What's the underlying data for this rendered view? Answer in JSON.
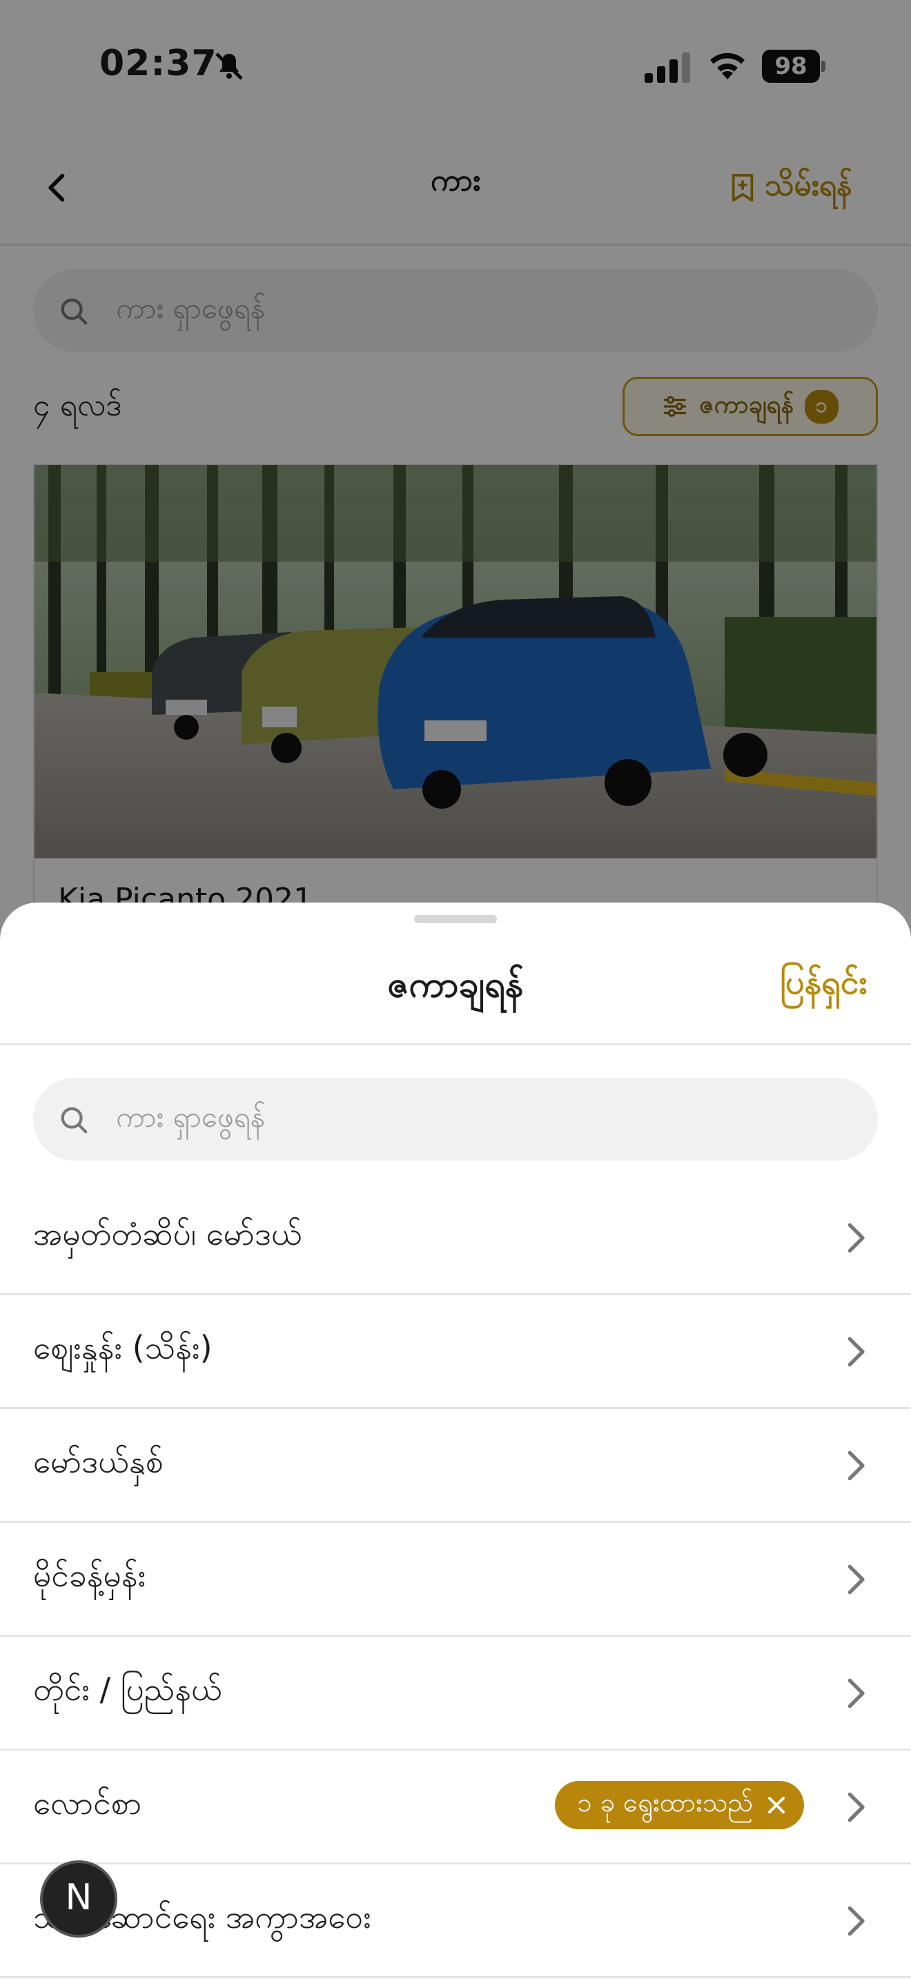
{
  "status_bar": {
    "time": "02:37",
    "battery": "98"
  },
  "nav": {
    "title": "ကား",
    "save_label": "သိမ်းရန်"
  },
  "search": {
    "placeholder": "ကား ရှာဖွေရန်"
  },
  "results": {
    "count_label": "၄ ရလဒ်",
    "filter_label": "ဇကာချရန်",
    "filter_count": "၁"
  },
  "card": {
    "title": "Kia Picanto 2021"
  },
  "sheet": {
    "title": "ဇကာချရန်",
    "reset_label": "ပြန်ရှင်း",
    "search_placeholder": "ကား ရှာဖွေရန်",
    "items": [
      {
        "label": "အမှတ်တံဆိပ်၊ မော်ဒယ်"
      },
      {
        "label": "စျေးနှုန်း (သိန်း)"
      },
      {
        "label": "မော်ဒယ်နှစ်"
      },
      {
        "label": "မိုင်ခန့်မှန်း"
      },
      {
        "label": "တိုင်း / ပြည်နယ်"
      },
      {
        "label": "လောင်စာ",
        "chip": "၁ ခု ရွေးထားသည်"
      },
      {
        "label": "သယ်ဆောင်ရေး အကွာအဝေး"
      }
    ]
  },
  "fab": {
    "label": "N"
  },
  "colors": {
    "accent": "#b88a0b",
    "chip": "#b8860b"
  }
}
